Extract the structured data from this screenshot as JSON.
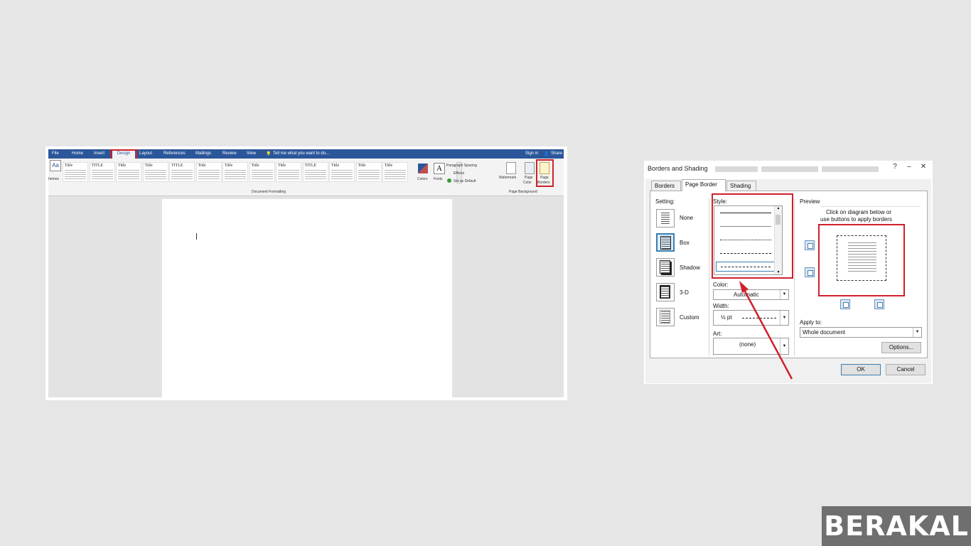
{
  "word": {
    "tabs": [
      "File",
      "Home",
      "Insert",
      "Design",
      "Layout",
      "References",
      "Mailings",
      "Review",
      "View"
    ],
    "tell_me": "Tell me what you want to do...",
    "sign_in": "Sign in",
    "share": "Share",
    "themes_label": "hemes",
    "style_titles": [
      "Title",
      "TITLE",
      "Title",
      "Title",
      "TITLE",
      "Title",
      "Title",
      "Title",
      "Title",
      "TITLE",
      "Title",
      "Title",
      "Title"
    ],
    "colors_label": "Colors",
    "fonts_label": "Fonts",
    "paragraph_spacing": "Paragraph Spacing",
    "effects": "Effects",
    "set_as_default": "Set as Default",
    "watermark": "Watermark",
    "page_color_1": "Page",
    "page_color_2": "Color",
    "page_borders_1": "Page",
    "page_borders_2": "Borders",
    "group_document_formatting": "Document Formatting",
    "group_page_background": "Page Background"
  },
  "dialog": {
    "title": "Borders and Shading",
    "tabs": [
      "Borders",
      "Page Border",
      "Shading"
    ],
    "active_tab": "Page Border",
    "setting_label": "Setting:",
    "settings": [
      "None",
      "Box",
      "Shadow",
      "3-D",
      "Custom"
    ],
    "style_label": "Style:",
    "color_label": "Color:",
    "color_value": "Automatic",
    "width_label": "Width:",
    "width_value": "½ pt",
    "art_label": "Art:",
    "art_value": "(none)",
    "preview_label": "Preview",
    "preview_hint_1": "Click on diagram below or",
    "preview_hint_2": "use buttons to apply borders",
    "apply_to_label": "Apply to:",
    "apply_to_value": "Whole document",
    "options_button": "Options...",
    "ok_button": "OK",
    "cancel_button": "Cancel"
  },
  "brand": "BERAKAL",
  "colors": {
    "word_blue": "#2b579a",
    "highlight_red": "#d0202a"
  }
}
